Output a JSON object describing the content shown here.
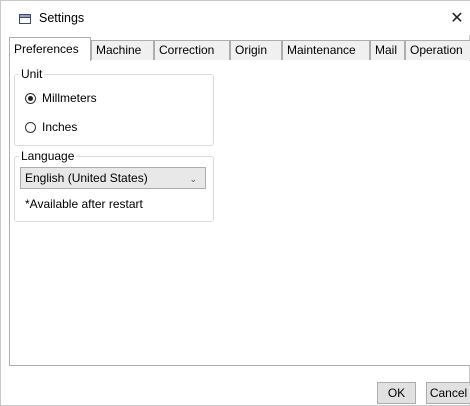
{
  "window": {
    "title": "Settings",
    "close_glyph": "✕",
    "icon": "settings-window-icon"
  },
  "tabs": [
    {
      "label": "Preferences",
      "active": true
    },
    {
      "label": "Machine",
      "active": false
    },
    {
      "label": "Correction",
      "active": false
    },
    {
      "label": "Origin",
      "active": false
    },
    {
      "label": "Maintenance",
      "active": false
    },
    {
      "label": "Mail",
      "active": false
    },
    {
      "label": "Operation",
      "active": false
    }
  ],
  "unit": {
    "group_label": "Unit",
    "options": [
      {
        "label": "Millmeters",
        "checked": true
      },
      {
        "label": "Inches",
        "checked": false
      }
    ]
  },
  "language": {
    "group_label": "Language",
    "selected": "English (United States)",
    "hint": "*Available after restart"
  },
  "footer": {
    "ok_label": "OK",
    "cancel_label": "Cancel"
  }
}
